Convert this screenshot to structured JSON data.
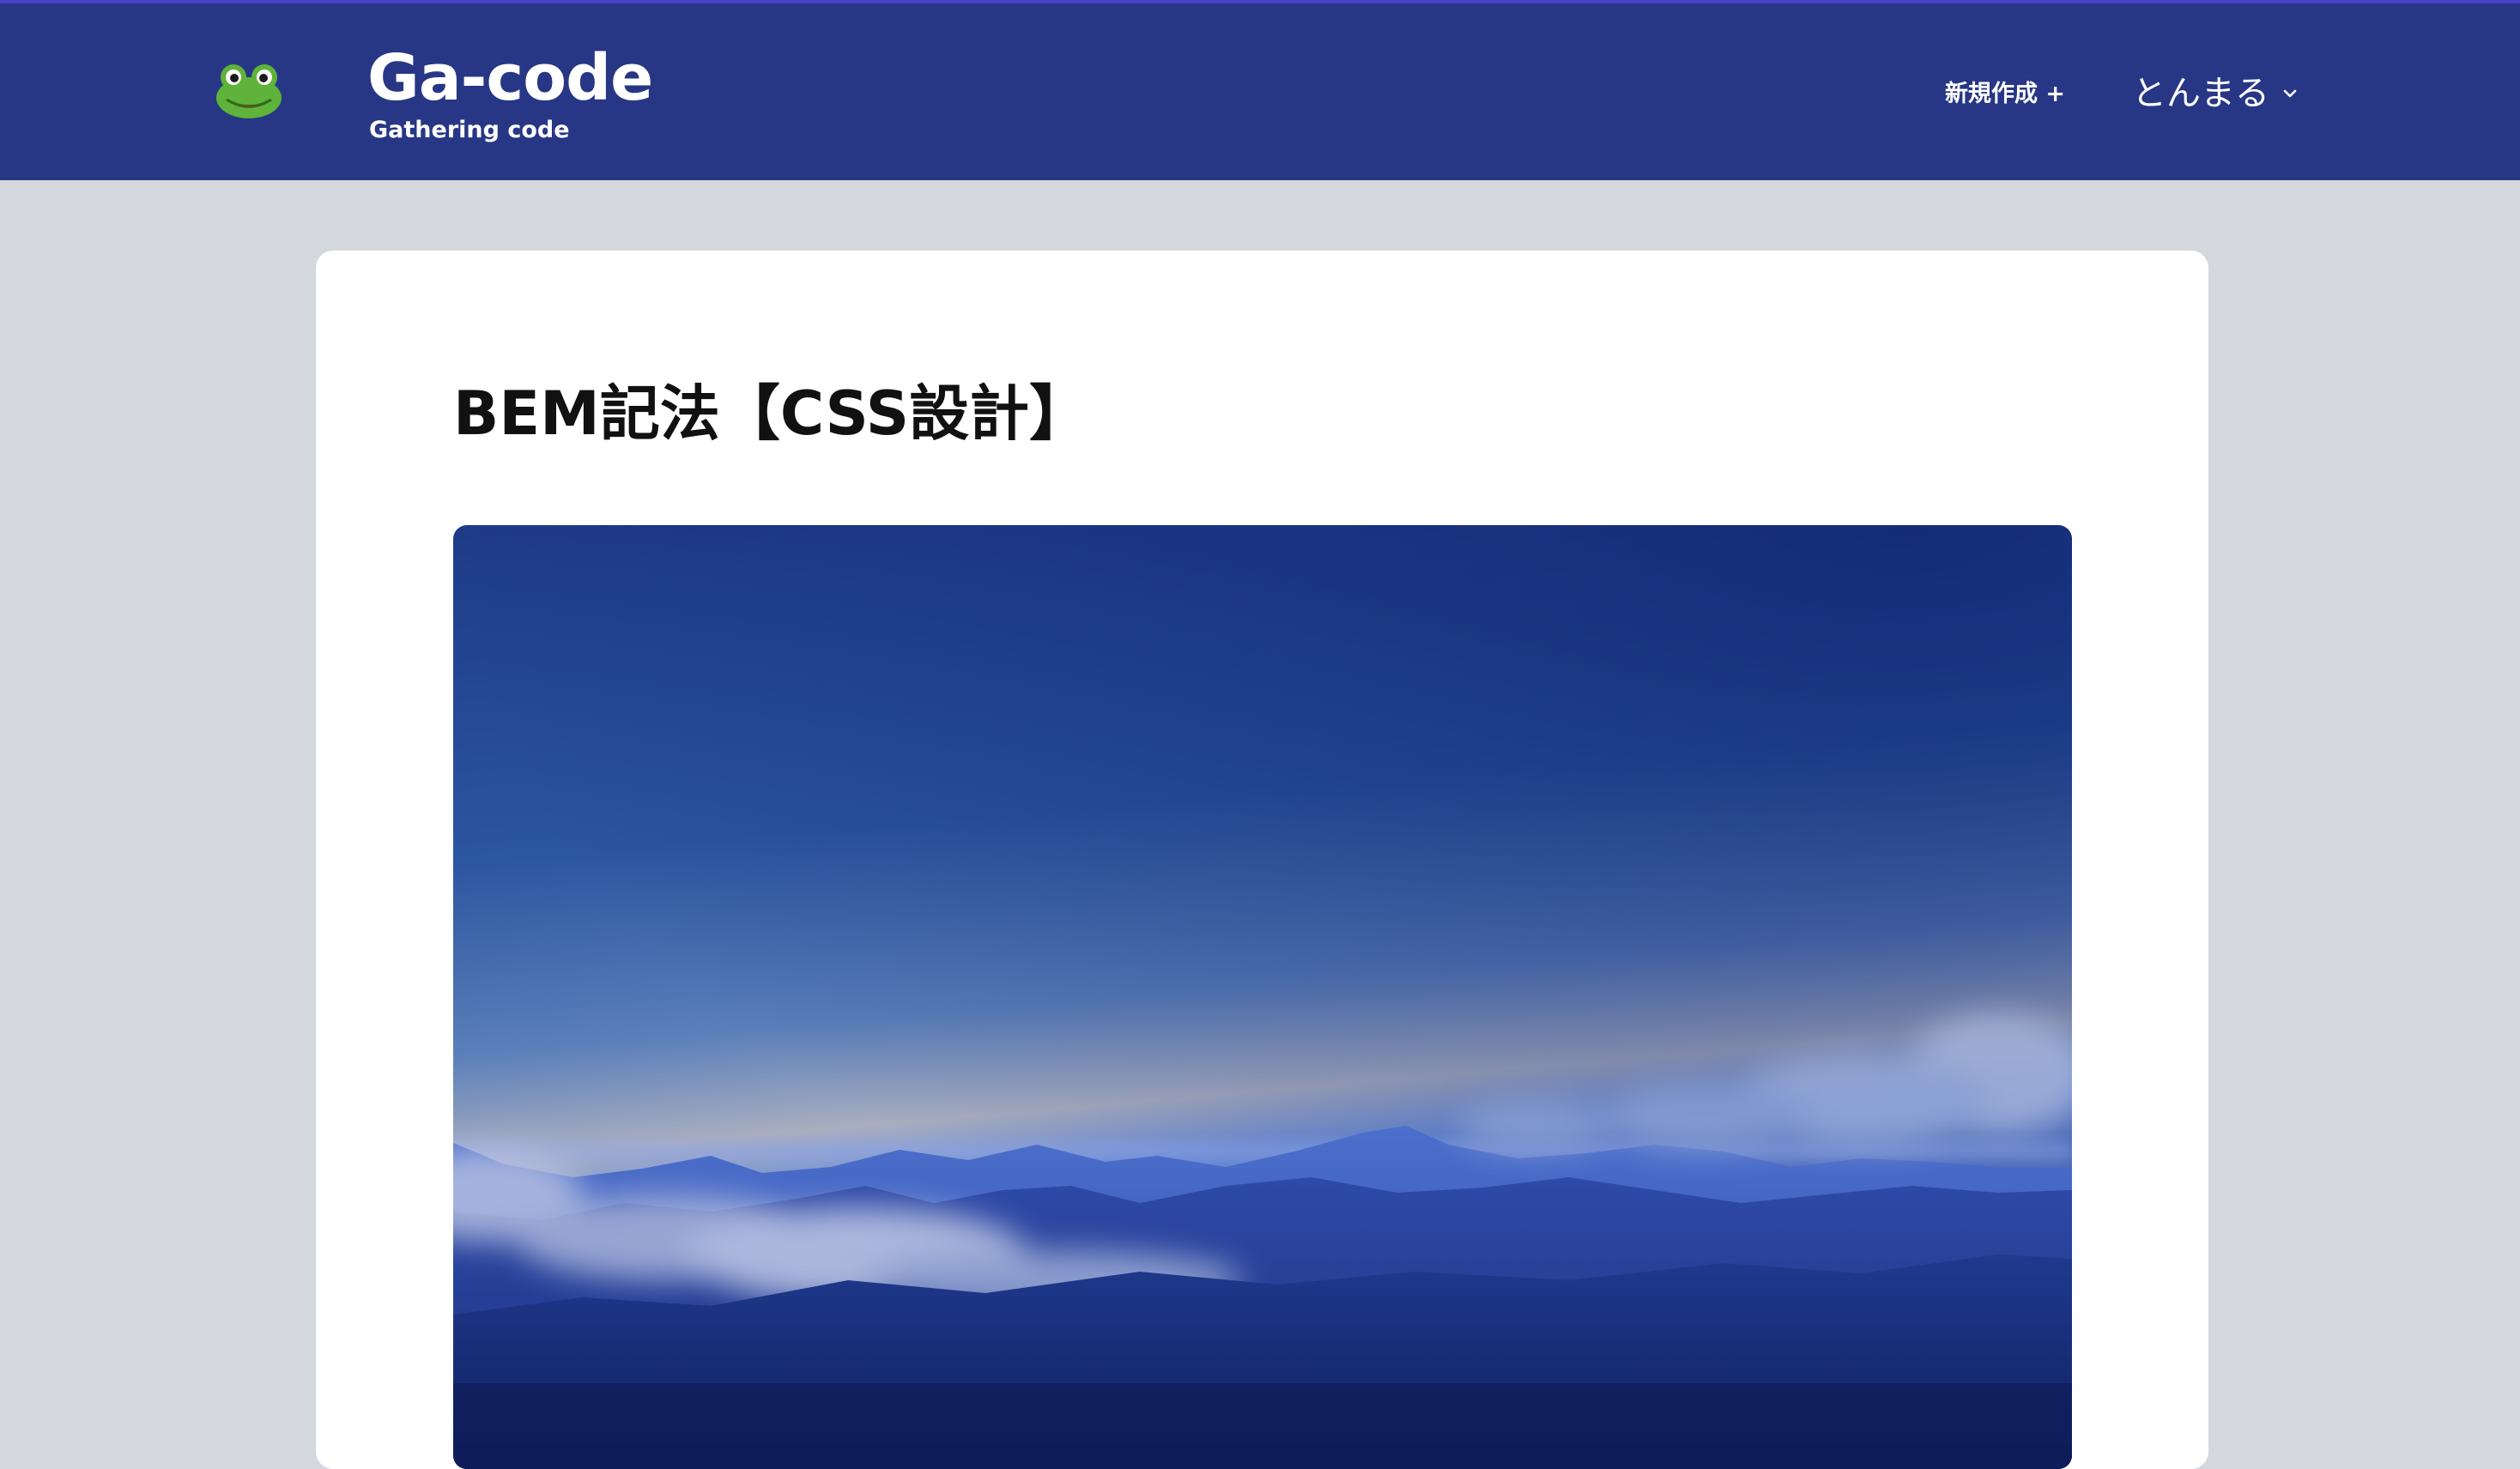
{
  "header": {
    "brand_title": "Ga-code",
    "brand_subtitle": "Gathering code",
    "logo_icon": "frog-icon",
    "new_post_label": "新規作成 +",
    "user_name": "とんまる",
    "user_menu_icon": "chevron-down-icon",
    "background_color": "#273785"
  },
  "article": {
    "title": "BEM記法【CSS設計】",
    "hero_image": "mountain-sky-image"
  }
}
